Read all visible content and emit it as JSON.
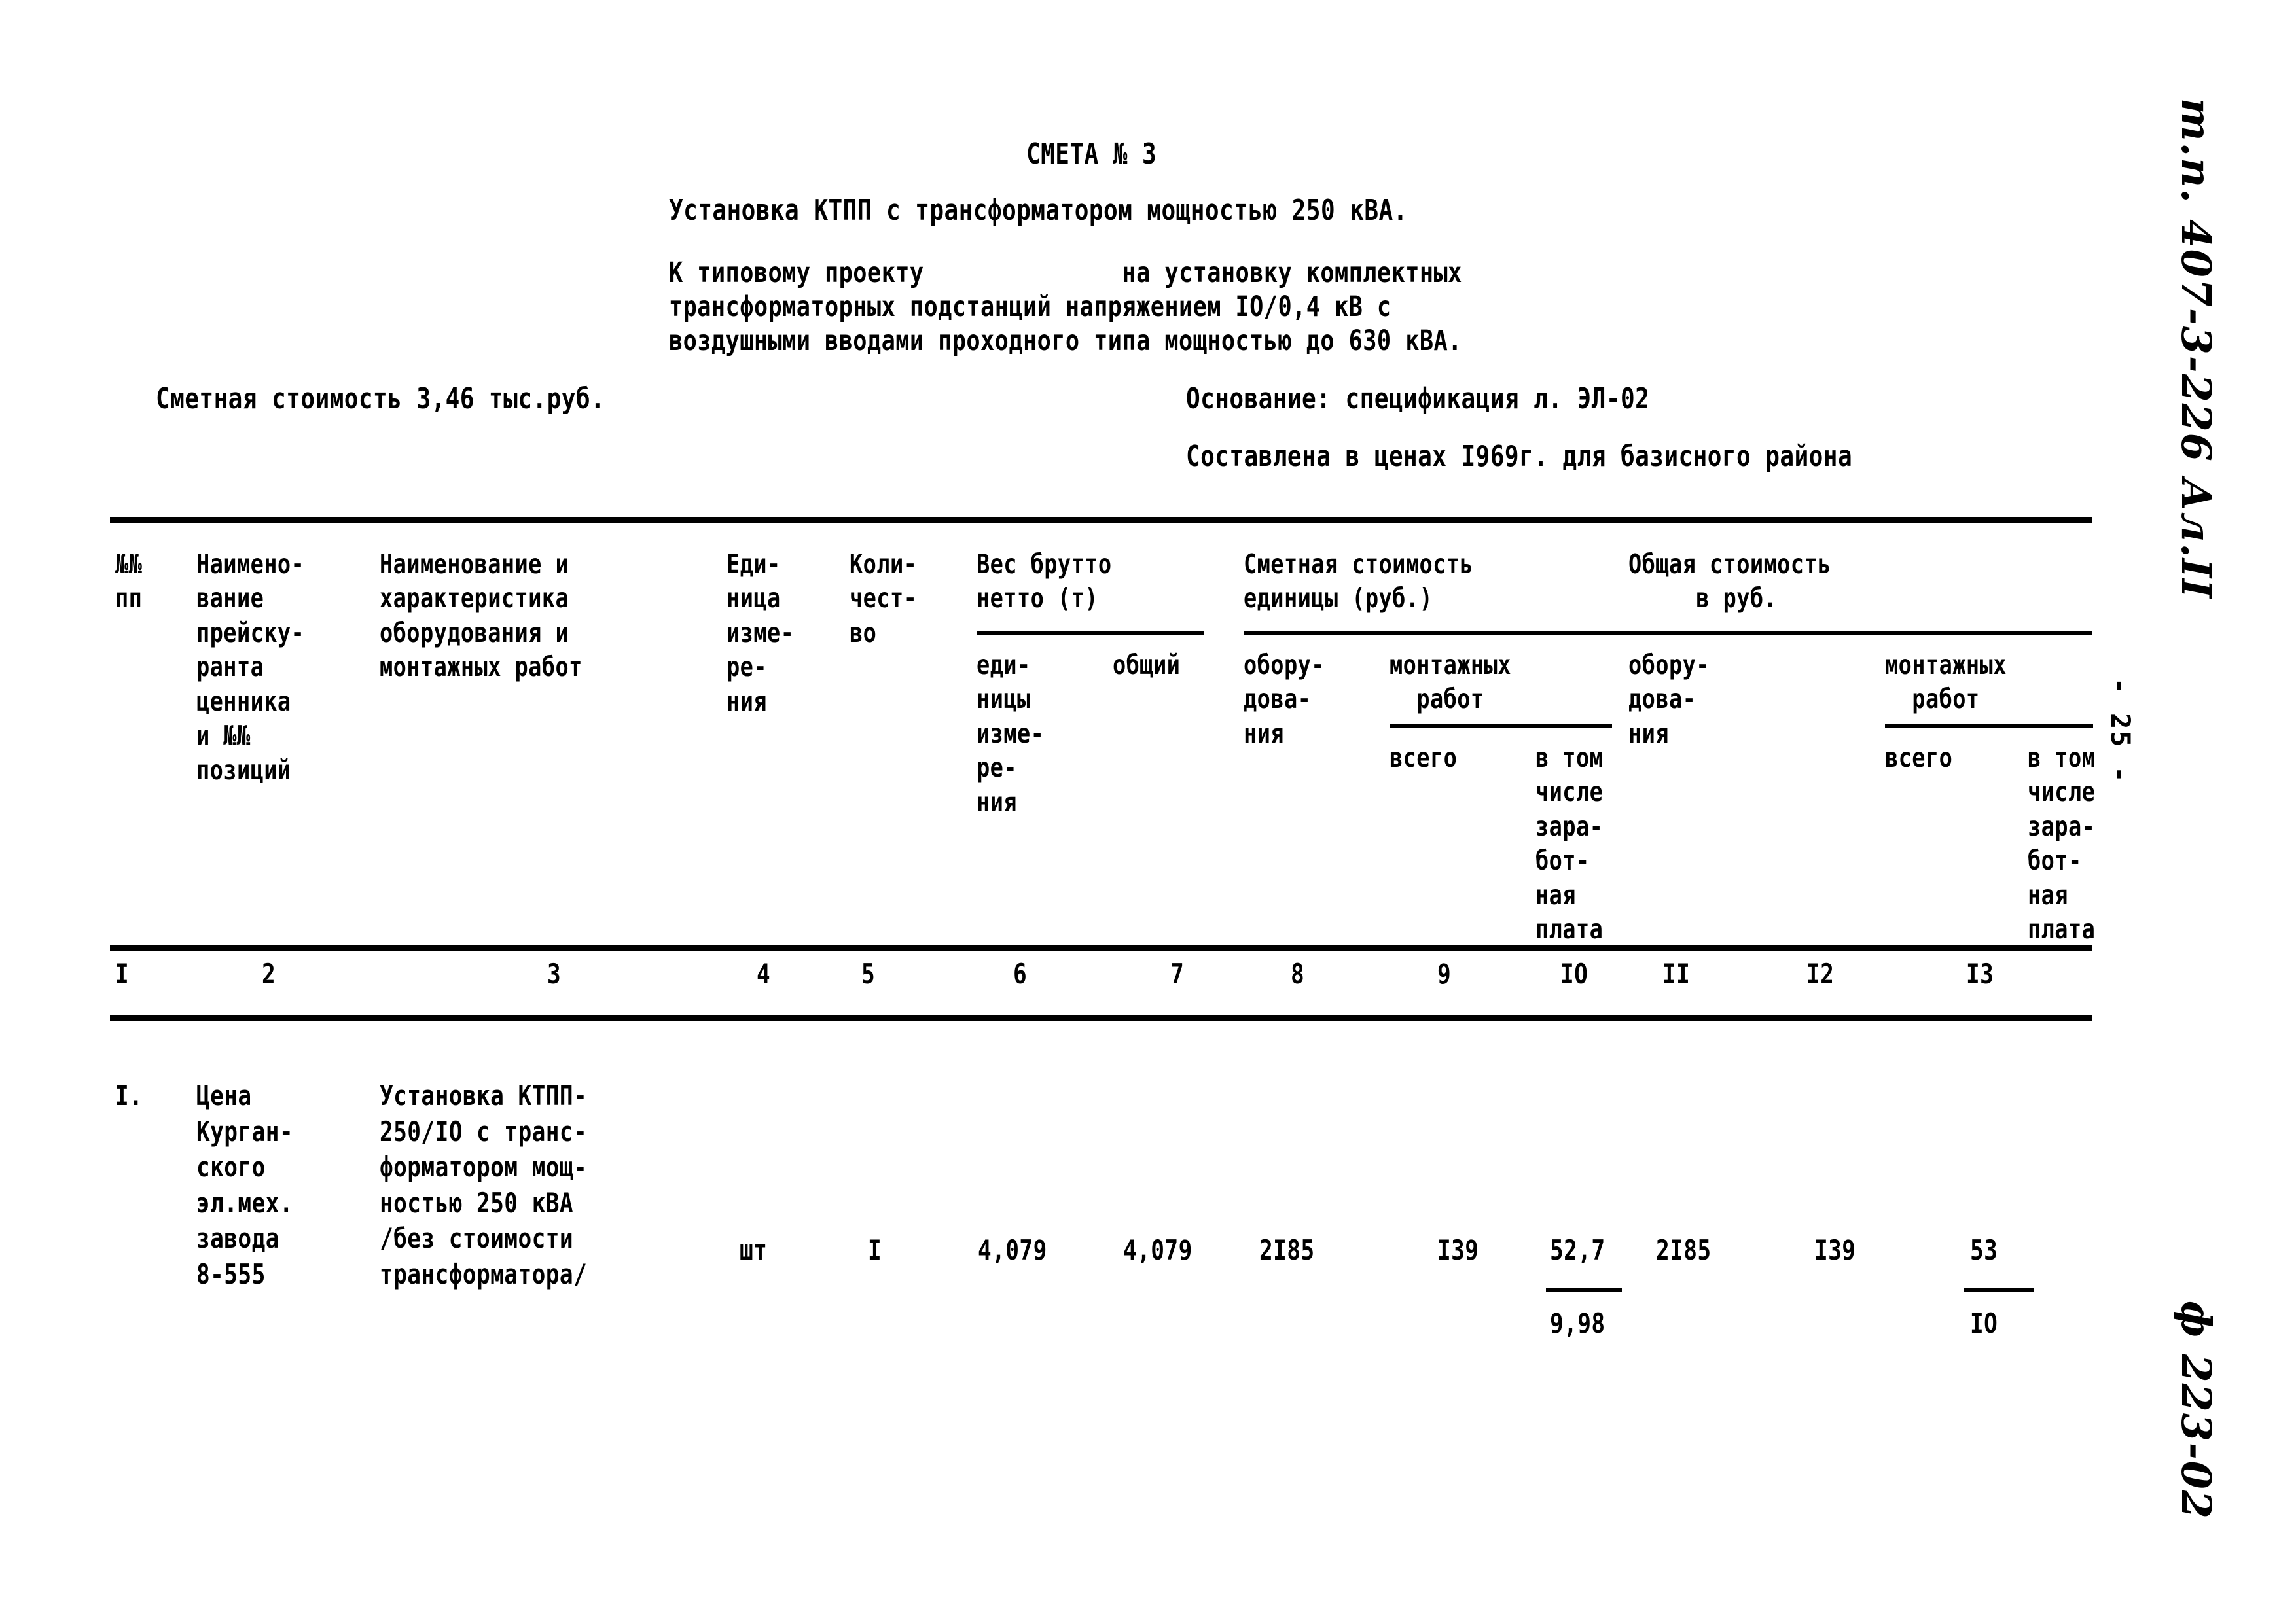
{
  "heading": {
    "smeta_title": "СМЕТА № 3",
    "subtitle": "Установка КТПП с трансформатором мощностью 250 кВА.",
    "paragraph_line1": "К типовому проекту              на установку комплектных",
    "paragraph_line2": "трансформаторных подстанций напряжением IО/0,4 кВ с",
    "paragraph_line3": "воздушными вводами проходного типа мощностью до 630 кВА.",
    "estimated_cost": "Сметная стоимость 3,46 тыс.руб.",
    "basis": "Основание: спецификация л. ЭЛ-02",
    "prices_note": "Составлена в ценах I969г. для базисного района"
  },
  "table": {
    "headers": {
      "col1": "№№\nпп",
      "col2": "Наимено-\nвание\nпрейску-\nранта\nценника\nи №№\nпозиций",
      "col3": "Наименование и\nхарактеристика\nоборудования и\nмонтажных работ",
      "col4": "Еди-\nница\nизме-\nре-\nния",
      "col5": "Коли-\nчест-\nво",
      "col6_group": "Вес брутто\nнетто (т)",
      "col6_sub_unit": "еди-\nницы\nизме-\nре-\nния",
      "col7_sub_total": "общий",
      "col8_group": "Сметная стоимость\nединицы (руб.)",
      "col8_equipment": "обору-\nдова-\nния",
      "col9_10_montage": "монтажных\n  работ",
      "col9_all": "всего",
      "col10_incl": "в том\nчисле\nзара-\nбот-\nная\nплата",
      "col11_group": "Общая стоимость\n     в руб.",
      "col11_equipment": "обору-\nдова-\nния",
      "col12_13_montage": "монтажных\n  работ",
      "col12_all": "всего",
      "col13_incl": "в том\nчисле\nзара-\nбот-\nная\nплата"
    },
    "column_numbers": [
      "I",
      "2",
      "3",
      "4",
      "5",
      "6",
      "7",
      "8",
      "9",
      "IO",
      "II",
      "I2",
      "I3"
    ],
    "rows": [
      {
        "position": "I.",
        "pricelist": "Цена\nКурган-\nского\nэл.мех.\nзавода\n8-555",
        "description": "Установка КТПП-\n250/IО с транс-\nформатором мощ-\nностью 250 кВА\n/без стоимости\nтрансформатора/",
        "unit": "шт",
        "quantity": "I",
        "weight_unit": "4,079",
        "weight_total": "4,079",
        "unit_cost_equipment": "2I85",
        "unit_cost_montage_all": "I39",
        "unit_cost_montage_wage_top": "52,7",
        "unit_cost_montage_wage_bottom": "9,98",
        "total_equipment": "2I85",
        "total_montage_all": "I39",
        "total_montage_wage_top": "53",
        "total_montage_wage_bottom": "IО"
      }
    ]
  },
  "margins": {
    "project_code": "т.п. 407-3-226 Ал.II",
    "page_number": "- 25 -",
    "sheet_ref": "ф 223-02"
  }
}
